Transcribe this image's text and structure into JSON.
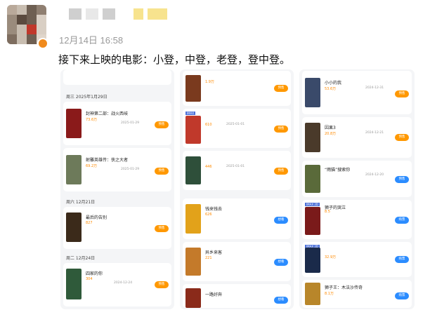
{
  "post": {
    "time": "12月14日 16:58",
    "text": "接下来上映的电影：小登，中登，老登，登中登。"
  },
  "shots": [
    {
      "sections": [
        {
          "label": "周三  2025年1月29日",
          "cards": [
            {
              "title": "封神第二部：战火西岐",
              "hot": "73.6万",
              "date": "2025-01-29",
              "btn": "预售"
            },
            {
              "title": "射雕英雄传：侠之大者",
              "hot": "69.2万",
              "date": "2025-01-29",
              "btn": "预售"
            }
          ]
        },
        {
          "label": "周六  12月21日",
          "cards": [
            {
              "title": "最后的告别",
              "hot": "827",
              "date": "",
              "btn": "预售"
            }
          ]
        },
        {
          "label": "周二  12月24日",
          "cards": [
            {
              "title": "四家的你",
              "hot": "304",
              "date": "2024-12-24",
              "btn": "预售"
            }
          ]
        }
      ]
    },
    {
      "cards": [
        {
          "title": "",
          "hot": "1.9万",
          "btn": "预售"
        },
        {
          "title": "",
          "hot": "610",
          "date": "2025-01-01",
          "btn": "预售"
        },
        {
          "title": "",
          "hot": "446",
          "date": "2025-01-01",
          "btn": "预售"
        },
        {
          "title": "钱来钱去",
          "hot": "626",
          "btn": "想看"
        },
        {
          "title": "异乡来客",
          "hot": "221",
          "btn": "想看"
        },
        {
          "title": "一路好奔",
          "hot": "",
          "btn": "想看"
        }
      ]
    },
    {
      "cards": [
        {
          "title": "小小的我",
          "hot": "53.6万",
          "date": "2024-12-31",
          "btn": "预售"
        },
        {
          "title": "因果3",
          "hot": "20.8万",
          "date": "2024-12-21",
          "btn": "预售"
        },
        {
          "title": "“雨猫”搜索你",
          "hot": "",
          "date": "2024-12-20",
          "btn": "预售"
        },
        {
          "title": "狮子的哭泣",
          "hot": "8.5",
          "btn": "购票"
        },
        {
          "title": "",
          "hot": "32.9万",
          "btn": "购票"
        },
        {
          "title": "狮子王：木法沙传奇",
          "hot": "8.1万",
          "btn": "购票"
        }
      ]
    }
  ]
}
